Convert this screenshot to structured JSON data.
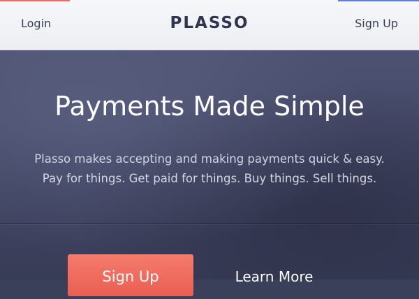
{
  "nav": {
    "login_label": "Login",
    "brand": "PLASSO",
    "signup_label": "Sign Up"
  },
  "hero": {
    "title": "Payments Made Simple",
    "subtitle_line1": "Plasso makes accepting and making payments quick & easy.",
    "subtitle_line2": "Pay for things. Get paid for things. Buy things. Sell things.",
    "primary_button_label": "Sign Up",
    "secondary_button_label": "Learn More"
  },
  "colors": {
    "accent_red": "#f06a5e",
    "accent_blue": "#5b7fdc",
    "hero_background": "#3f4462",
    "cta_button": "#ea5f52"
  }
}
